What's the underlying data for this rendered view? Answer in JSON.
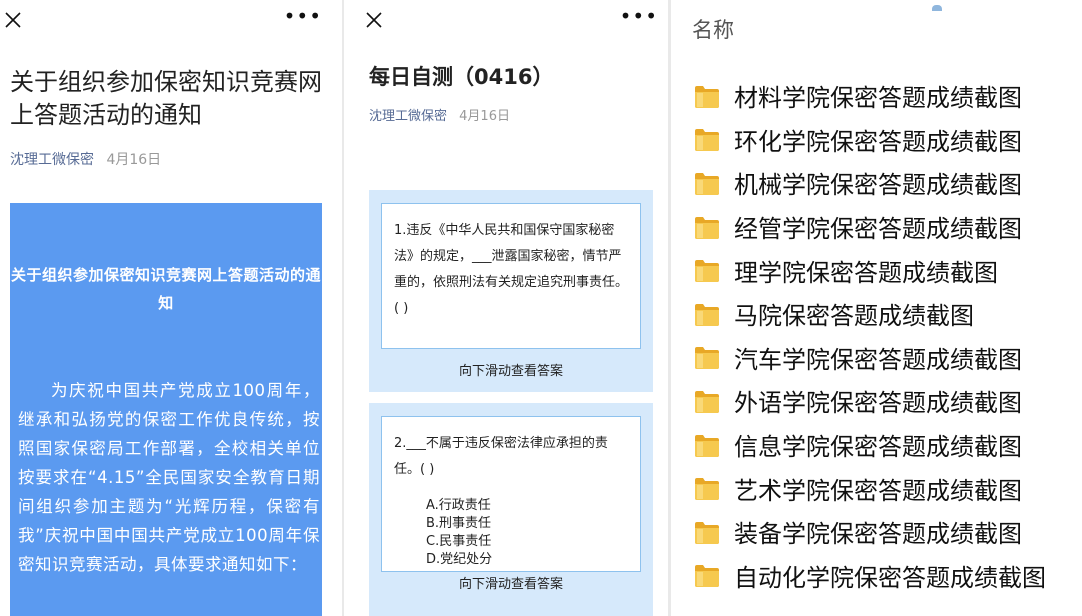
{
  "panel1": {
    "title": "关于组织参加保密知识竞赛网上答题活动的通知",
    "author": "沈理工微保密",
    "date": "4月16日",
    "banner_title": "关于组织参加保密知识竞赛网上答题活动的通知",
    "banner_body": "为庆祝中国共产党成立100周年，继承和弘扬党的保密工作优良传统，按照国家保密局工作部署，全校相关单位按要求在“4.15”全民国家安全教育日期间组织参加主题为“光辉历程，保密有我”庆祝中国中国共产党成立100周年保密知识竞赛活动，具体要求通知如下："
  },
  "panel2": {
    "title": "每日自测（0416）",
    "author": "沈理工微保密",
    "date": "4月16日",
    "questions": [
      {
        "text": "1.违反《中华人民共和国保守国家秘密法》的规定，___泄露国家秘密，情节严重的，依照刑法有关规定追究刑事责任。( )",
        "swipe": "向下滑动查看答案"
      },
      {
        "text": "2.___不属于违反保密法律应承担的责任。( )",
        "options": [
          "A.行政责任",
          "B.刑事责任",
          "C.民事责任",
          "D.党纪处分"
        ],
        "swipe": "向下滑动查看答案"
      }
    ]
  },
  "panel3": {
    "header": "名称",
    "folders": [
      "材料学院保密答题成绩截图",
      "环化学院保密答题成绩截图",
      "机械学院保密答题成绩截图",
      "经管学院保密答题成绩截图",
      "理学院保密答题成绩截图",
      "马院保密答题成绩截图",
      "汽车学院保密答题成绩截图",
      "外语学院保密答题成绩截图",
      "信息学院保密答题成绩截图",
      "艺术学院保密答题成绩截图",
      "装备学院保密答题成绩截图",
      "自动化学院保密答题成绩截图"
    ]
  },
  "icons": {
    "close": "close-icon",
    "more": "more-icon",
    "folder": "folder-icon"
  },
  "colors": {
    "author_link": "#576b95",
    "banner_bg": "#5b9af0",
    "question_card_bg": "#d6e9fb",
    "question_border": "#8ec2ee",
    "folder": "#f1b93a"
  }
}
